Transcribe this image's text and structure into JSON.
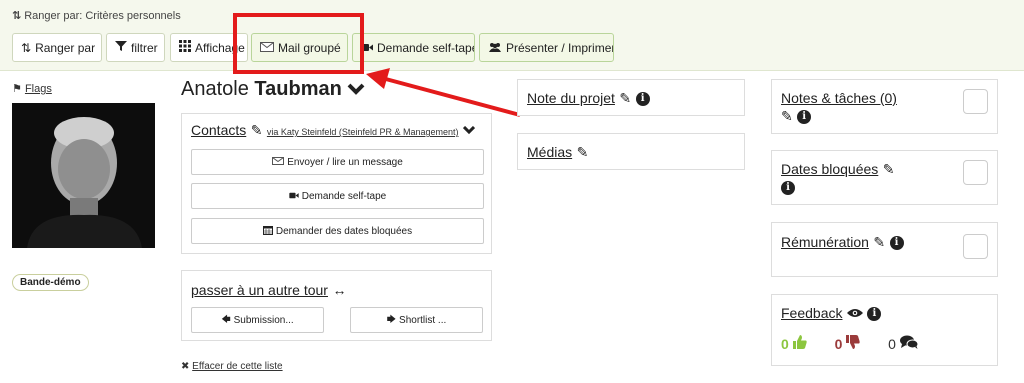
{
  "toolbar": {
    "sort_caption": "Ranger par: Critères personnels",
    "buttons": {
      "sort": "Ranger par",
      "filter": "filtrer",
      "display": "Affichage",
      "group_mail": "Mail groupé",
      "self_tape": "Demande self-tape",
      "present": "Présenter / Imprimer"
    }
  },
  "left": {
    "flags": "Flags",
    "tag": "Bande-démo"
  },
  "actor": {
    "first_name": "Anatole",
    "last_name": "Taubman"
  },
  "contacts": {
    "title": "Contacts",
    "via": "via Katy Steinfeld (Steinfeld PR & Management)",
    "buttons": {
      "message": "Envoyer / lire un message",
      "self_tape": "Demande self-tape",
      "blocked_dates": "Demander des dates bloquées"
    }
  },
  "tour": {
    "title": "passer à un autre tour",
    "submission": "Submission...",
    "shortlist": "Shortlist ..."
  },
  "clear_list": "Effacer de cette liste",
  "project": {
    "note": "Note du projet",
    "media": "Médias"
  },
  "right": {
    "notes": "Notes & tâches (0)",
    "blocked": "Dates bloquées",
    "remuneration": "Rémunération",
    "feedback": "Feedback",
    "feedback_counts": {
      "positive": "0",
      "negative": "0",
      "comments": "0"
    }
  },
  "colors": {
    "highlight": "#e31b1b",
    "positive": "#8cc63f",
    "negative": "#9b3b3b"
  }
}
